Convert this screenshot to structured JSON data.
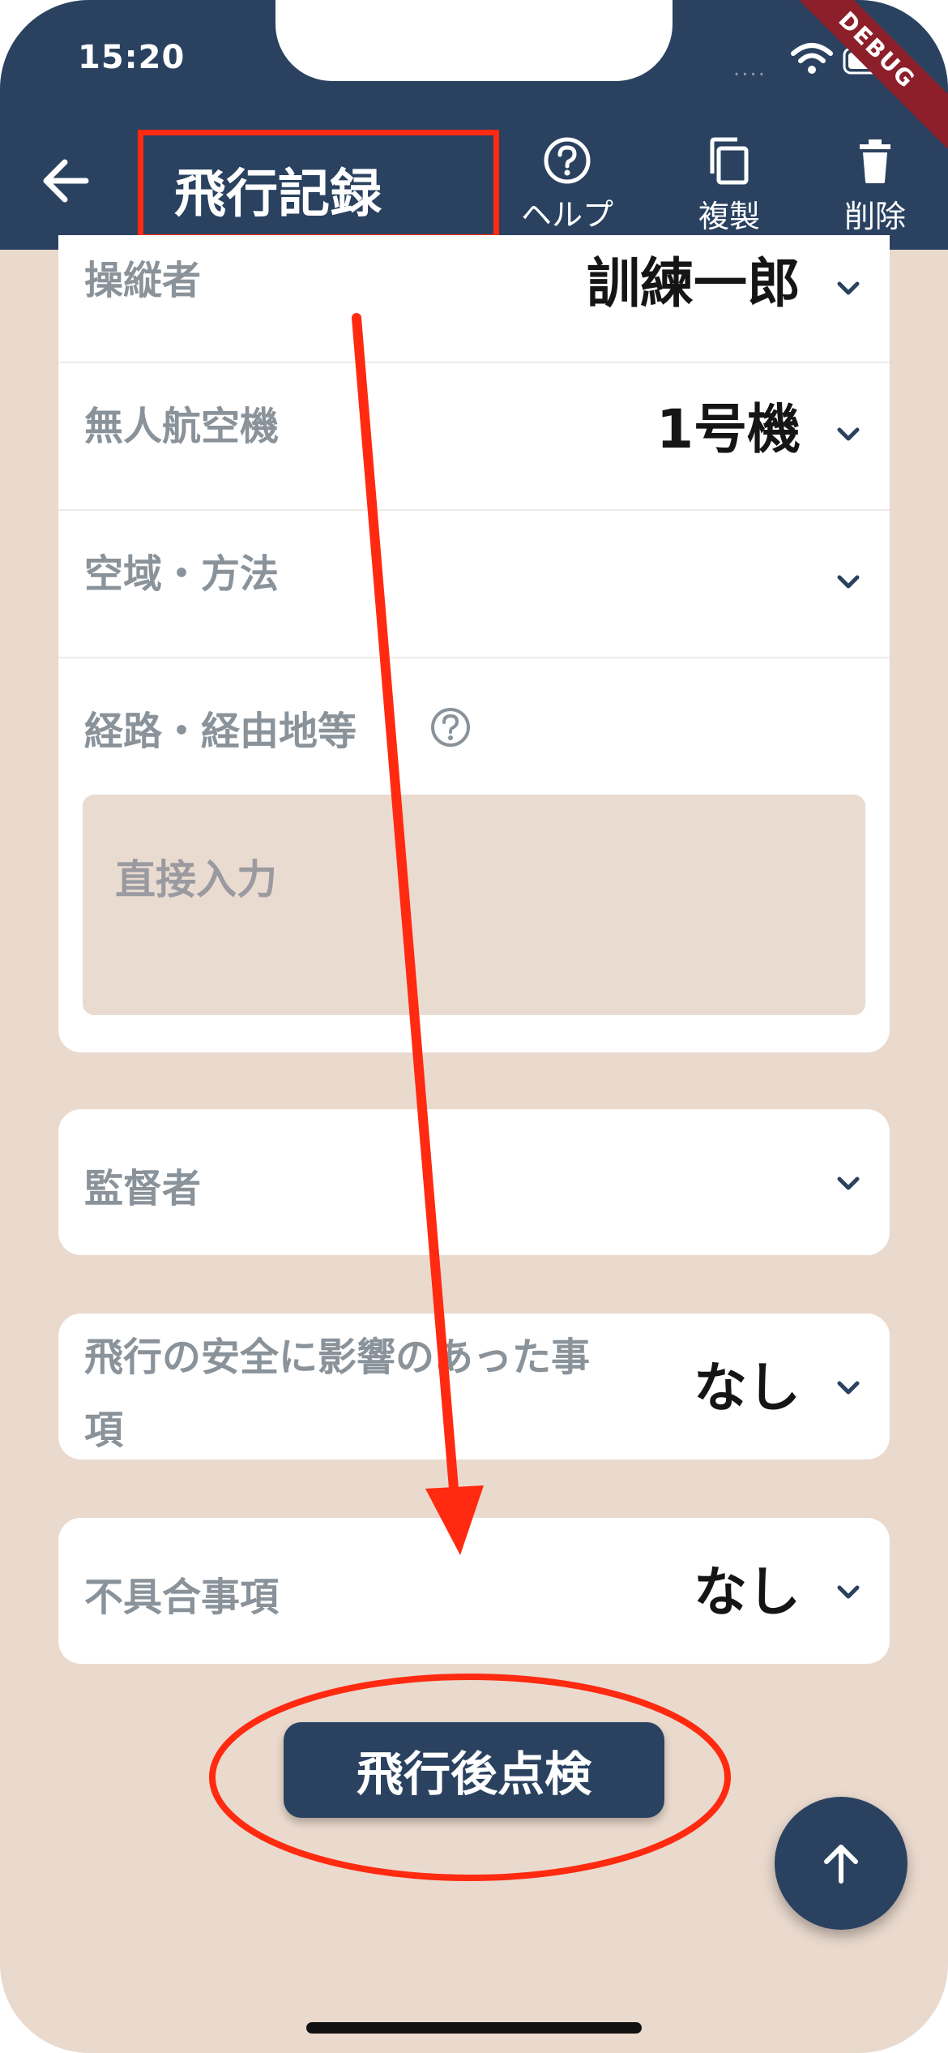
{
  "status_bar": {
    "time": "15:20",
    "signal": "....",
    "debug_label": "DEBUG"
  },
  "header": {
    "title": "飛行記録",
    "actions": {
      "help": "ヘルプ",
      "duplicate": "複製",
      "delete": "削除"
    }
  },
  "form": {
    "operator": {
      "label": "操縦者",
      "value": "訓練一郎"
    },
    "aircraft": {
      "label": "無人航空機",
      "value": "1号機"
    },
    "airspace": {
      "label": "空域・方法",
      "value": ""
    },
    "route": {
      "label": "経路・経由地等",
      "placeholder": "直接入力"
    },
    "supervisor": {
      "label": "監督者",
      "value": ""
    },
    "safety": {
      "label_line1": "飛行の安全に影響のあった事",
      "label_line2": "項",
      "value": "なし"
    },
    "defects": {
      "label": "不具合事項",
      "value": "なし"
    }
  },
  "post_flight_button": "飛行後点検",
  "colors": {
    "header": "#2a4260",
    "background": "#ead9cd",
    "annotation": "#ff2a10"
  },
  "icons": [
    "back-arrow-icon",
    "help-icon",
    "copy-icon",
    "trash-icon",
    "chevron-down-icon",
    "arrow-up-icon",
    "wifi-icon",
    "battery-icon"
  ]
}
